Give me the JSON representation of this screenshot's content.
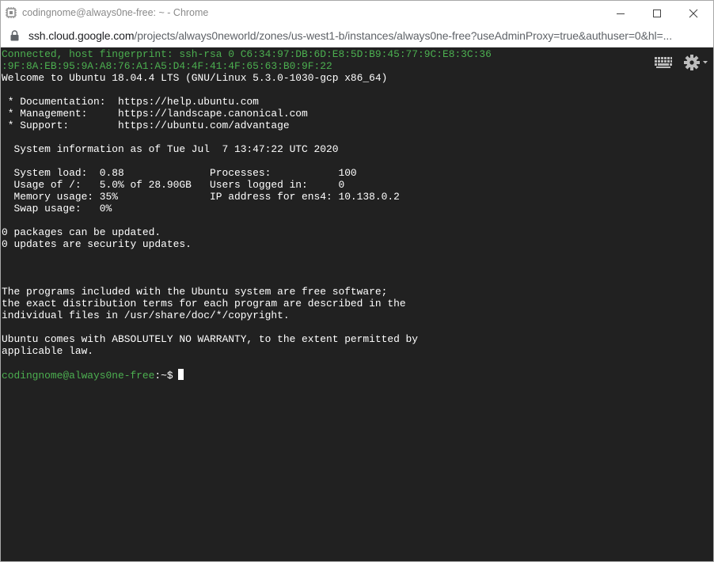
{
  "window": {
    "title": "codingnome@always0ne-free: ~ - Chrome"
  },
  "address": {
    "host": "ssh.cloud.google.com",
    "path": "/projects/always0neworld/zones/us-west1-b/instances/always0ne-free?useAdminProxy=true&authuser=0&hl=..."
  },
  "terminal": {
    "fingerprint_lines": [
      "Connected, host fingerprint: ssh-rsa 0 C6:34:97:DB:6D:E8:5D:B9:45:77:9C:E8:3C:36",
      ":9F:8A:EB:95:9A:A8:76:A1:A5:D4:4F:41:4F:65:63:B0:9F:22"
    ],
    "lines": [
      "Welcome to Ubuntu 18.04.4 LTS (GNU/Linux 5.3.0-1030-gcp x86_64)",
      "",
      " * Documentation:  https://help.ubuntu.com",
      " * Management:     https://landscape.canonical.com",
      " * Support:        https://ubuntu.com/advantage",
      "",
      "  System information as of Tue Jul  7 13:47:22 UTC 2020",
      "",
      "  System load:  0.88              Processes:           100",
      "  Usage of /:   5.0% of 28.90GB   Users logged in:     0",
      "  Memory usage: 35%               IP address for ens4: 10.138.0.2",
      "  Swap usage:   0%",
      "",
      "0 packages can be updated.",
      "0 updates are security updates.",
      "",
      "",
      "",
      "The programs included with the Ubuntu system are free software;",
      "the exact distribution terms for each program are described in the",
      "individual files in /usr/share/doc/*/copyright.",
      "",
      "Ubuntu comes with ABSOLUTELY NO WARRANTY, to the extent permitted by",
      "applicable law.",
      ""
    ],
    "prompt": {
      "user_host": "codingnome@always0ne-free",
      "path": ":~$"
    }
  },
  "icons": {
    "app": "chrome-app-icon",
    "lock": "lock-icon",
    "keyboard": "keyboard-icon",
    "settings": "gear-icon"
  },
  "colors": {
    "terminal_bg": "#212121",
    "terminal_text": "#ffffff",
    "prompt_green": "#4caf50"
  }
}
